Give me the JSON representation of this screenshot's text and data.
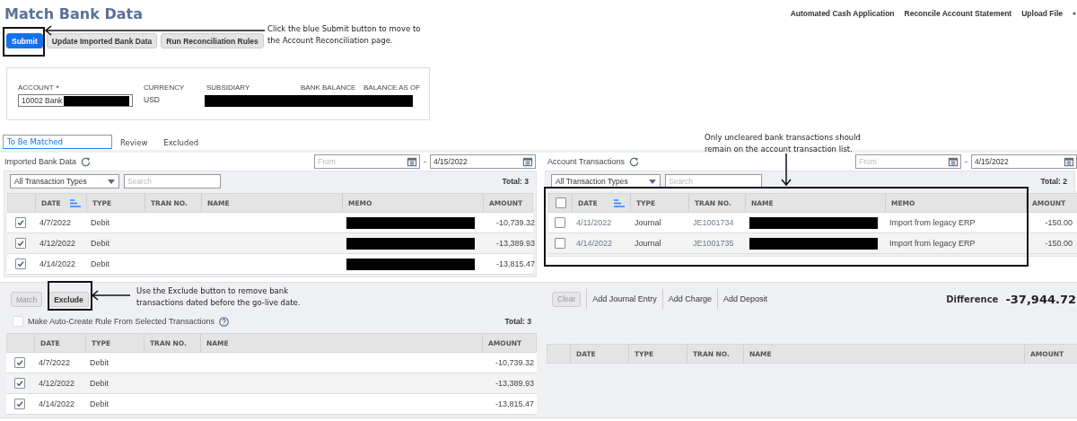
{
  "title": "Match Bank Data",
  "header_links": [
    "Automated Cash Application",
    "Reconcile Account Statement",
    "Upload File"
  ],
  "buttons": [
    {
      "label": "Submit",
      "kind": "primary"
    },
    {
      "label": "Update Imported Bank Data",
      "kind": "secondary"
    },
    {
      "label": "Run Reconciliation Rules",
      "kind": "secondary"
    }
  ],
  "account": {
    "account_label": "ACCOUNT",
    "required_mark": "*",
    "account_value": "10002 Bank",
    "account_redacted": true,
    "currency_label": "CURRENCY",
    "currency_value": "USD",
    "subsidiary_label": "SUBSIDIARY",
    "bank_balance_label": "BANK BALANCE",
    "balance_as_of_label": "BALANCE AS OF",
    "details_redacted": true
  },
  "tabs": [
    {
      "label": "To Be Matched",
      "selected": true
    },
    {
      "label": "Review",
      "selected": false
    },
    {
      "label": "Excluded",
      "selected": false
    }
  ],
  "imported_bank_data": {
    "title": "Imported Bank Data",
    "date_from": {
      "placeholder": "From"
    },
    "range_separator": "-",
    "date_to": {
      "value": "4/15/2022"
    },
    "type_filter": "All Transaction Types",
    "search": {
      "placeholder": "Search"
    },
    "total": "Total: 3",
    "columns": [
      {
        "label": "DATE",
        "sorted": true
      },
      {
        "label": "TYPE",
        "sorted": false
      },
      {
        "label": "TRAN NO.",
        "sorted": false
      },
      {
        "label": "NAME",
        "sorted": false
      },
      {
        "label": "MEMO",
        "sorted": false
      },
      {
        "label": "AMOUNT",
        "sorted": false
      }
    ],
    "rows": [
      {
        "checked": true,
        "date": "4/7/2022",
        "type": "Debit",
        "memo_redacted": true,
        "amount": "-10,739.32"
      },
      {
        "checked": true,
        "date": "4/12/2022",
        "type": "Debit",
        "memo_redacted": true,
        "amount": "-13,389.93"
      },
      {
        "checked": true,
        "date": "4/14/2022",
        "type": "Debit",
        "memo_redacted": true,
        "amount": "-13,815.47"
      }
    ]
  },
  "account_transactions": {
    "title": "Account Transactions",
    "date_from": {
      "placeholder": "From"
    },
    "range_separator": "-",
    "date_to": {
      "value": "4/15/2022"
    },
    "type_filter": "All Transaction Types",
    "search": {
      "placeholder": "Search"
    },
    "total": "Total: 2",
    "select_all_checked": false,
    "columns": [
      {
        "label": "DATE",
        "sorted": true
      },
      {
        "label": "TYPE",
        "sorted": false
      },
      {
        "label": "TRAN NO.",
        "sorted": false
      },
      {
        "label": "NAME",
        "sorted": false
      },
      {
        "label": "MEMO",
        "sorted": false
      },
      {
        "label": "AMOUNT",
        "sorted": false
      }
    ],
    "rows": [
      {
        "checked": false,
        "date": "4/11/2022",
        "type": "Journal",
        "tran_no": "JE1001734",
        "name_redacted": true,
        "memo": "Import from legacy ERP",
        "amount": "-150.00"
      },
      {
        "checked": false,
        "date": "4/14/2022",
        "type": "Journal",
        "tran_no": "JE1001735",
        "name_redacted": true,
        "memo": "Import from legacy ERP",
        "amount": "-150.00"
      }
    ]
  },
  "match_panel": {
    "buttons": [
      {
        "label": "Match",
        "disabled": true
      },
      {
        "label": "Exclude",
        "disabled": false
      }
    ],
    "auto_rule": {
      "label": "Make Auto-Create Rule From Selected Transactions",
      "checked": false
    },
    "total": "Total: 3",
    "columns": [
      "DATE",
      "TYPE",
      "TRAN NO.",
      "NAME",
      "AMOUNT"
    ],
    "rows": [
      {
        "checked": true,
        "date": "4/7/2022",
        "type": "Debit",
        "amount": "-10,739.32"
      },
      {
        "checked": true,
        "date": "4/12/2022",
        "type": "Debit",
        "amount": "-13,389.93"
      },
      {
        "checked": true,
        "date": "4/14/2022",
        "type": "Debit",
        "amount": "-13,815.47"
      }
    ]
  },
  "adjust_panel": {
    "clear": {
      "label": "Clear",
      "disabled": true
    },
    "links": [
      "Add Journal Entry",
      "Add Charge",
      "Add Deposit"
    ],
    "difference_label": "Difference",
    "difference_value": "-37,944.72",
    "columns": [
      "DATE",
      "TYPE",
      "TRAN NO.",
      "NAME",
      "AMOUNT"
    ]
  },
  "callouts": [
    {
      "text": "Click the blue Submit button to move to the Account Reconciliation page."
    },
    {
      "text": "Only uncleared bank transactions should remain on the account transaction list."
    },
    {
      "text": "Use the Exclude button to remove bank transactions dated before the go-live date."
    }
  ]
}
